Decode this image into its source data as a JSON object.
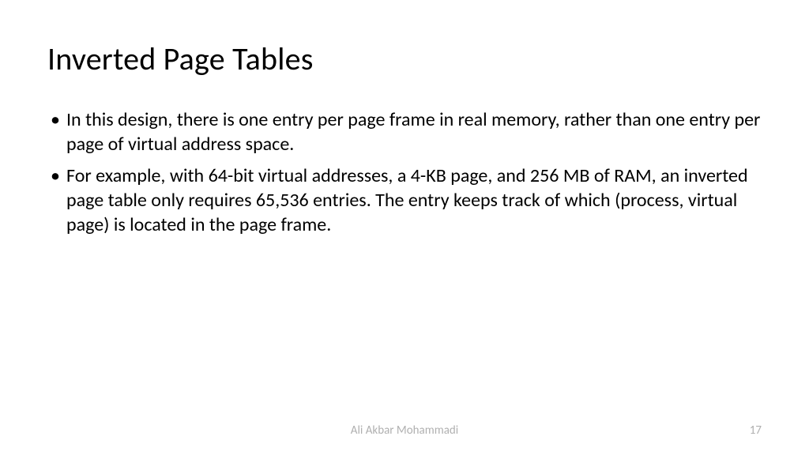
{
  "slide": {
    "title": "Inverted Page Tables",
    "bullets": [
      "In this design, there is one entry per page frame in real memory, rather than one entry per page of virtual address space.",
      "For example, with 64-bit virtual addresses, a 4-KB page, and 256 MB of RAM, an inverted page table only requires 65,536 entries. The entry keeps track of which (process, virtual page) is located in the page frame."
    ],
    "footer": {
      "author": "Ali Akbar Mohammadi",
      "page_number": "17"
    }
  }
}
